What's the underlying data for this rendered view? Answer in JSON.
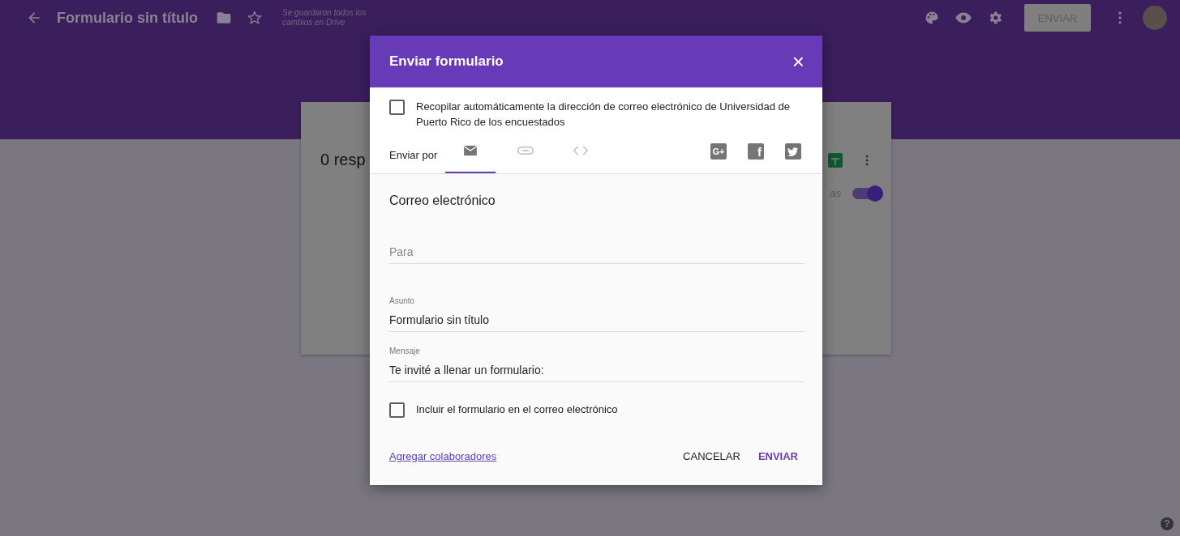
{
  "topbar": {
    "title": "Formulario sin título",
    "save_status": "Se guardaron todos los cambios en Drive",
    "send_button": "ENVIAR",
    "starred": false
  },
  "card": {
    "responses_label": "0 resp",
    "toggle_label": "as",
    "accepting": true
  },
  "help_glyph": "?",
  "dialog": {
    "title": "Enviar formulario",
    "close": "×",
    "collect_email": {
      "label": "Recopilar automáticamente la dirección de correo electrónico de Universidad de Puerto Rico de los encuestados",
      "checked": false
    },
    "send_via_label": "Enviar por",
    "tabs": [
      {
        "kind": "email",
        "selected": true
      },
      {
        "kind": "link",
        "selected": false
      },
      {
        "kind": "embed",
        "selected": false
      }
    ],
    "share": [
      {
        "kind": "gplus",
        "glyph": "G+"
      },
      {
        "kind": "facebook",
        "glyph": "f"
      },
      {
        "kind": "twitter"
      }
    ],
    "section_title": "Correo electrónico",
    "fields": [
      {
        "placeholder": "Para"
      },
      {
        "label": "Asunto",
        "value": "Formulario sin título"
      },
      {
        "label": "Mensaje",
        "value": "Te invité a llenar un formulario:"
      }
    ],
    "include_form": {
      "label": "Incluir el formulario en el correo electrónico",
      "checked": false
    },
    "collaborators_link": "Agregar colaboradores",
    "buttons": [
      {
        "kind": "cancel",
        "label": "CANCELAR"
      },
      {
        "kind": "send",
        "label": "ENVIAR"
      }
    ]
  }
}
